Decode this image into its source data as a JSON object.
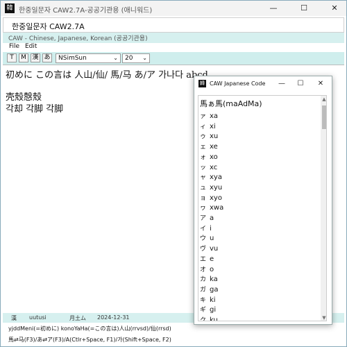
{
  "main": {
    "icon_label": "韓",
    "title": "한중일문자 CAW2.7A-공공기관용 (애니워드)",
    "app_header": "한중일문자 CAW2.7A",
    "subtitle": "CAW - Chinese, Japanese, Korean (공공기관용)",
    "menu": [
      "File",
      "Edit"
    ],
    "toolbar": {
      "buttons": [
        "T",
        "M",
        "漢",
        "あ"
      ],
      "font": "NSimSun",
      "size": "20"
    },
    "editor_lines": [
      "初めに この言は 人山/仙/ 馬/马 あ/ア 가나다 abcd",
      "壳殼慤殼",
      "각却 각脚 각脚"
    ],
    "status": {
      "char": "漢",
      "reading": "uutusi",
      "date_label": "月土ム",
      "date": "2024-12-31"
    },
    "help_lines": [
      "yjddMeni(=初めに) konoYaHa(=この言は)人山(rrvsd)/仙(rrsd)",
      "馬⇄马(F3)/あ⇄ア(F3)/A(Ctlr+Space, F1)/가(Shift+Space, F2)"
    ]
  },
  "child_window": {
    "title": "CAW Japanese Code",
    "header_text": "馬ぁ馬(maAdMa)",
    "rows": [
      {
        "kana": "ァ",
        "romaji": "xa"
      },
      {
        "kana": "ィ",
        "romaji": "xi"
      },
      {
        "kana": "ゥ",
        "romaji": "xu"
      },
      {
        "kana": "ェ",
        "romaji": "xe"
      },
      {
        "kana": "ォ",
        "romaji": "xo"
      },
      {
        "kana": "ッ",
        "romaji": "xc"
      },
      {
        "kana": "ャ",
        "romaji": "xya"
      },
      {
        "kana": "ュ",
        "romaji": "xyu"
      },
      {
        "kana": "ョ",
        "romaji": "xyo"
      },
      {
        "kana": "ヮ",
        "romaji": "xwa"
      },
      {
        "kana": "ア",
        "romaji": "a"
      },
      {
        "kana": "イ",
        "romaji": "i"
      },
      {
        "kana": "ウ",
        "romaji": "u"
      },
      {
        "kana": "ヴ",
        "romaji": "vu"
      },
      {
        "kana": "エ",
        "romaji": "e"
      },
      {
        "kana": "オ",
        "romaji": "o"
      },
      {
        "kana": "カ",
        "romaji": "ka"
      },
      {
        "kana": "ガ",
        "romaji": "ga"
      },
      {
        "kana": "キ",
        "romaji": "ki"
      },
      {
        "kana": "ギ",
        "romaji": "gi"
      },
      {
        "kana": "ク",
        "romaji": "ku"
      }
    ]
  },
  "controls": {
    "minimize": "—",
    "maximize": "☐",
    "close": "✕"
  },
  "colors": {
    "desktop": "#7fd3cf",
    "subtitle_bg": "#d6f0ef",
    "toolbar_bg": "#cfeeed"
  }
}
